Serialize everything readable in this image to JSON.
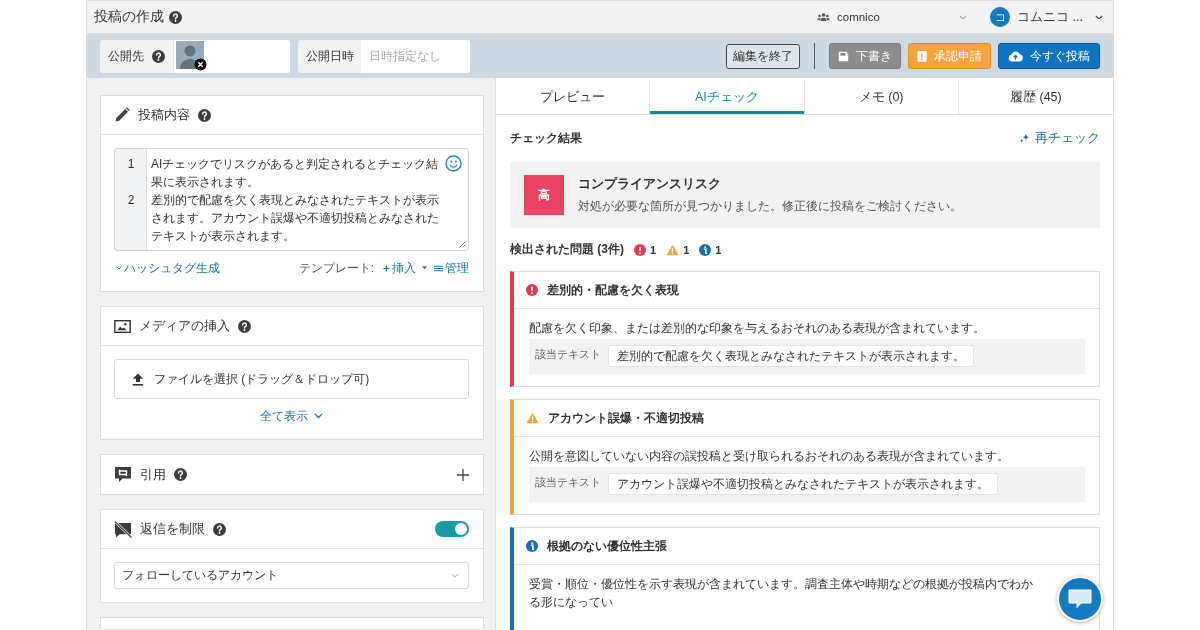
{
  "header": {
    "title": "投稿の作成",
    "workspace": "comnico",
    "user": {
      "initial": "コ",
      "name": "コムニコ ..."
    }
  },
  "toolbar": {
    "destination": {
      "label": "公開先"
    },
    "schedule": {
      "label": "公開日時",
      "placeholder": "日時指定なし"
    },
    "buttons": [
      {
        "label": "編集を終了",
        "kind": "finish"
      },
      {
        "label": "下書き",
        "kind": "draft"
      },
      {
        "label": "承認申請",
        "kind": "approval"
      },
      {
        "label": "今すぐ投稿",
        "kind": "publish"
      }
    ]
  },
  "post_content": {
    "title": "投稿内容",
    "lines": [
      {
        "number": "1",
        "text": "AIチェックでリスクがあると判定されるとチェック結果に表示されます。"
      },
      {
        "number": "2",
        "text": "差別的で配慮を欠く表現とみなされたテキストが表示されます。アカウント誤爆や不適切投稿とみなされたテキストが表示されます。"
      }
    ],
    "hashtag_link": "ハッシュタグ生成",
    "template_label": "テンプレート:",
    "template_actions": [
      {
        "kind": "insert",
        "label": "挿入"
      },
      {
        "kind": "manage",
        "label": "管理"
      }
    ]
  },
  "media": {
    "title": "メディアの挿入",
    "upload_label": "ファイルを選択 (ドラッグ＆ドロップ可)",
    "show_all": "全て表示"
  },
  "quote": {
    "title": "引用",
    "expanded": false
  },
  "reply_limit": {
    "title": "返信を制限",
    "on": true,
    "value": "フォローしているアカウント"
  },
  "ai_panel": {
    "tabs": [
      {
        "label": "プレビュー",
        "selected": false
      },
      {
        "label": "AIチェック",
        "selected": true
      },
      {
        "label": "メモ (0)",
        "selected": false
      },
      {
        "label": "履歴 (45)",
        "selected": false
      }
    ],
    "heading": "チェック結果",
    "recheck": "再チェック",
    "risk": {
      "kind": "high",
      "badge": "高",
      "title": "コンプライアンスリスク",
      "description": "対処が必要な箇所が見つかりました。修正後に投稿をご検討ください。"
    },
    "issues_heading": "検出された問題 (3件)",
    "counts": [
      {
        "kind": "error",
        "count": "1"
      },
      {
        "kind": "warning",
        "count": "1"
      },
      {
        "kind": "info",
        "count": "1"
      }
    ],
    "issues": [
      {
        "kind": "error",
        "title": "差別的・配慮を欠く表現",
        "description": "配慮を欠く印象、または差別的な印象を与えるおそれのある表現が含まれています。",
        "excerpt_label": "該当テキスト",
        "excerpt": "差別的で配慮を欠く表現とみなされたテキストが表示されます。"
      },
      {
        "kind": "warning",
        "title": "アカウント誤爆・不適切投稿",
        "description": "公開を意図していない内容の誤投稿と受け取られるおそれのある表現が含まれています。",
        "excerpt_label": "該当テキスト",
        "excerpt": "アカウント誤爆や不適切投稿とみなされたテキストが表示されます。"
      },
      {
        "kind": "info",
        "title": "根拠のない優位性主張",
        "description": "受賞・順位・優位性を示す表現が含まれています。調査主体や時期などの根拠が投稿内でわかる形になってい"
      }
    ]
  }
}
